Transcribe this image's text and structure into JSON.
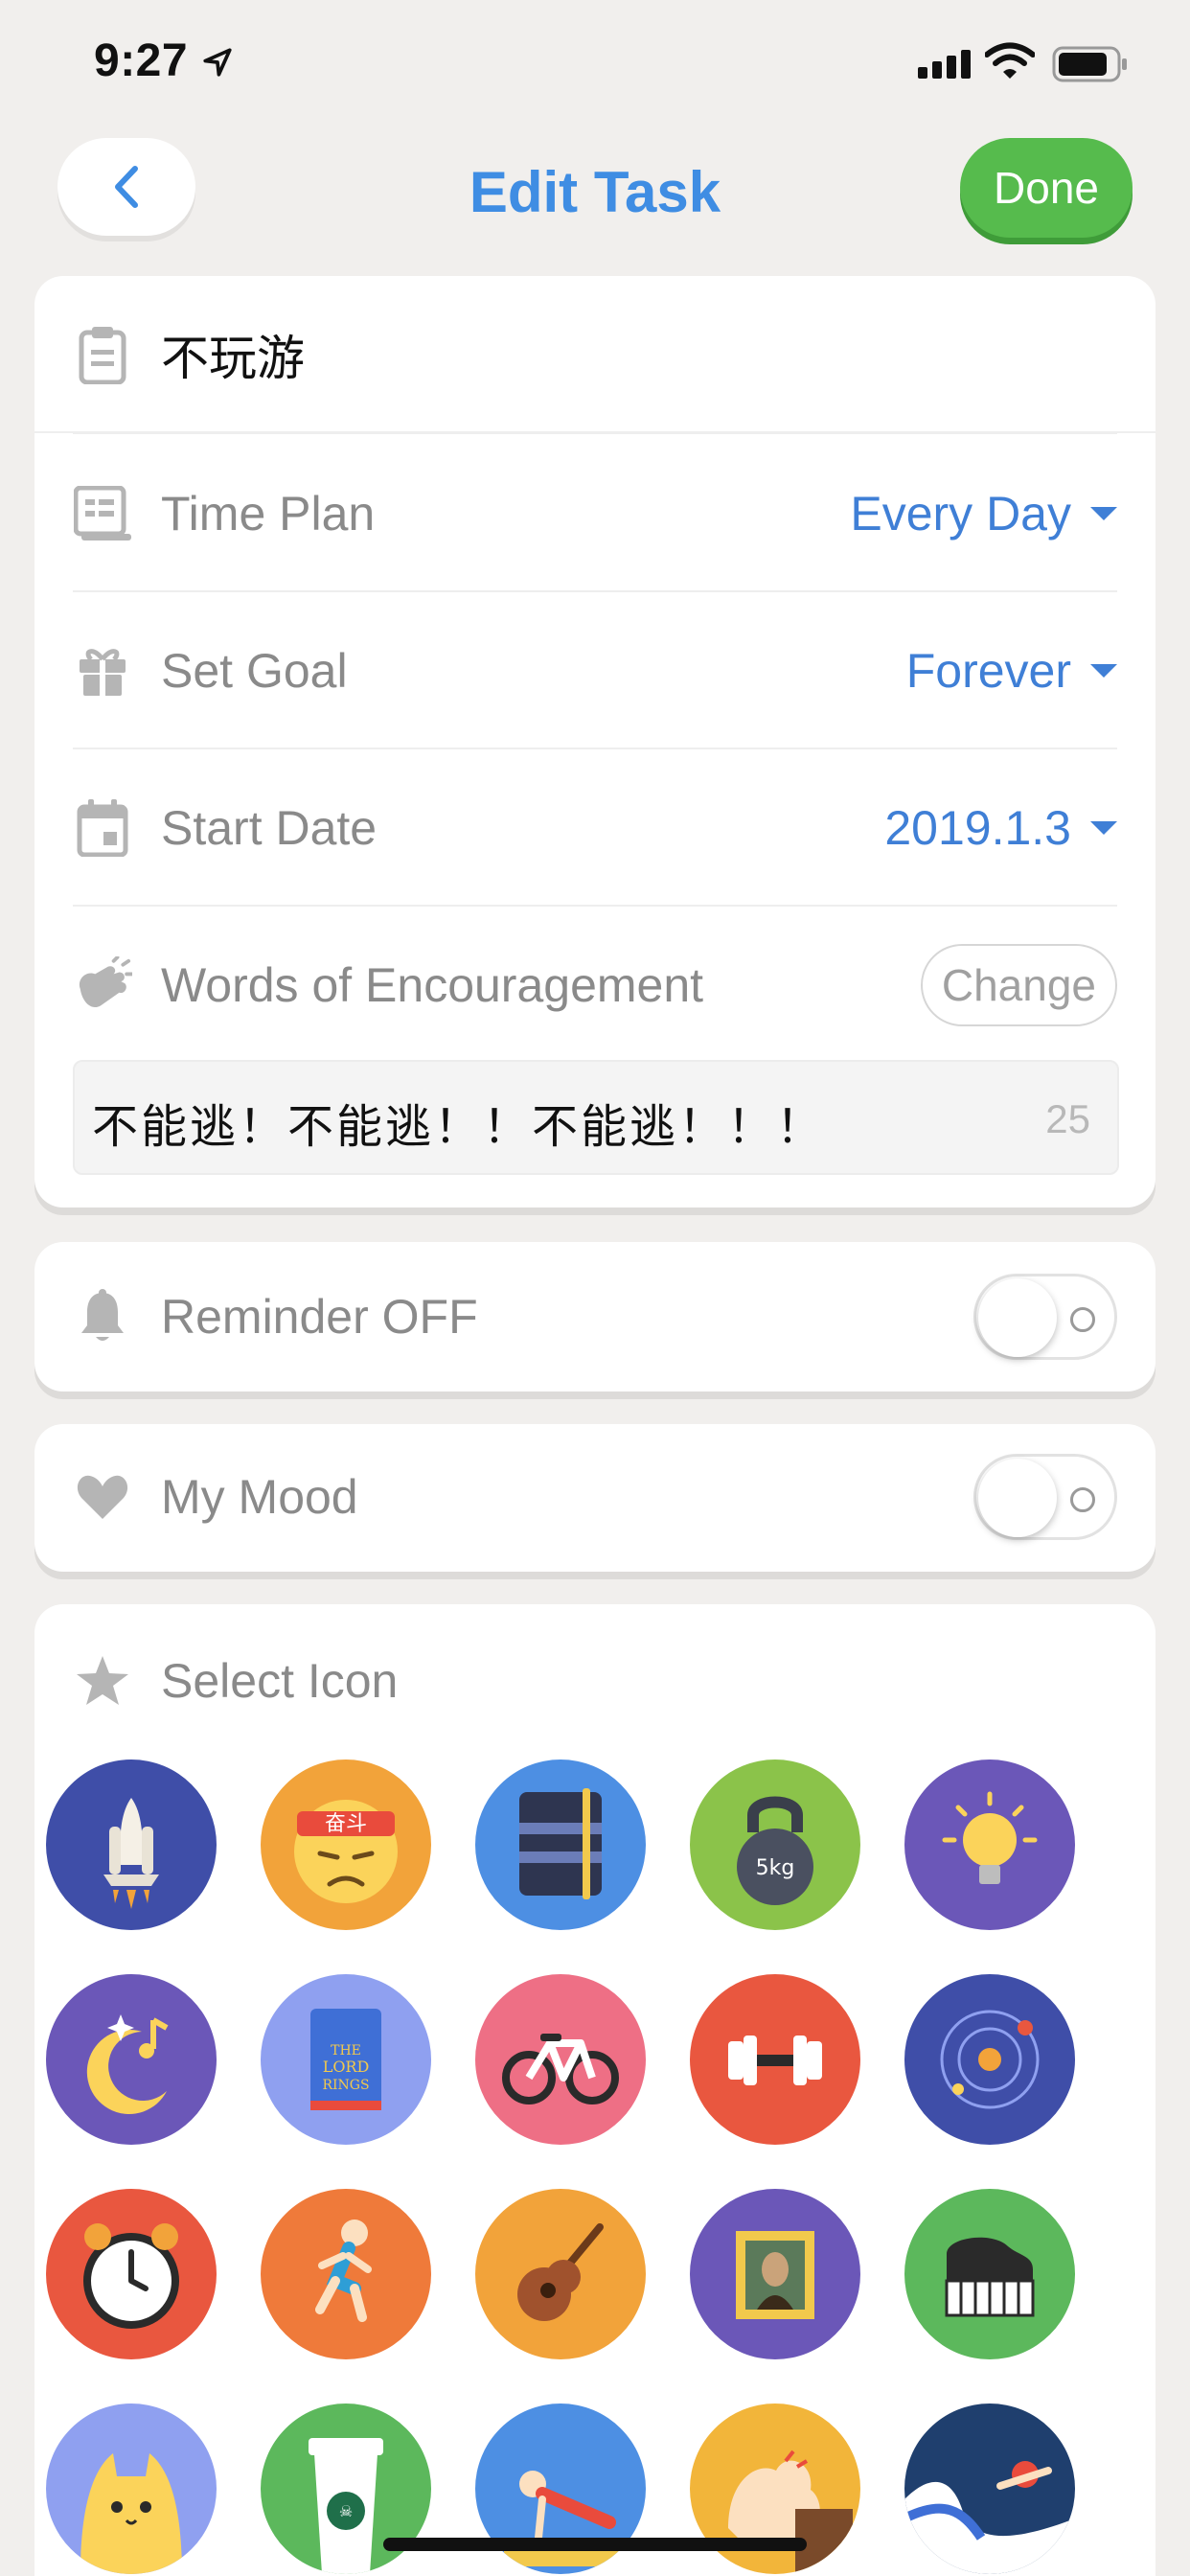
{
  "status": {
    "time": "9:27"
  },
  "nav": {
    "title": "Edit Task",
    "done_label": "Done"
  },
  "task": {
    "name": "不玩游",
    "time_plan_label": "Time Plan",
    "time_plan_value": "Every Day",
    "goal_label": "Set Goal",
    "goal_value": "Forever",
    "start_label": "Start Date",
    "start_value": "2019.1.3",
    "encouragement_label": "Words of Encouragement",
    "change_label": "Change",
    "encouragement_text": "不能逃！不能逃！！不能逃！！！",
    "char_count": "25"
  },
  "reminder": {
    "label": "Reminder OFF",
    "on": false
  },
  "mood": {
    "label": "My Mood",
    "on": false
  },
  "icons": {
    "label": "Select Icon",
    "items": [
      {
        "name": "rocket-icon",
        "bg": "#3f4ea8"
      },
      {
        "name": "headband-face-icon",
        "bg": "#f2a33a",
        "text": "奋斗"
      },
      {
        "name": "notebook-icon",
        "bg": "#4d8fe3"
      },
      {
        "name": "kettlebell-icon",
        "bg": "#8bc34a",
        "text": "5kg"
      },
      {
        "name": "lightbulb-icon",
        "bg": "#6b57b8"
      },
      {
        "name": "moon-music-icon",
        "bg": "#6b57b8"
      },
      {
        "name": "book-icon",
        "bg": "#8fa0f0"
      },
      {
        "name": "bicycle-icon",
        "bg": "#ee6f85"
      },
      {
        "name": "dumbbell-icon",
        "bg": "#e9573f"
      },
      {
        "name": "planet-icon",
        "bg": "#3f4ea8"
      },
      {
        "name": "alarm-clock-icon",
        "bg": "#e9573f"
      },
      {
        "name": "runner-icon",
        "bg": "#ef7a3a"
      },
      {
        "name": "guitar-icon",
        "bg": "#f2a33a"
      },
      {
        "name": "painting-icon",
        "bg": "#6b57b8"
      },
      {
        "name": "piano-icon",
        "bg": "#5cb85c"
      },
      {
        "name": "cat-icon",
        "bg": "#8fa0f0"
      },
      {
        "name": "coffee-icon",
        "bg": "#5cb85c"
      },
      {
        "name": "pushup-icon",
        "bg": "#4d8fe3"
      },
      {
        "name": "muscle-icon",
        "bg": "#f2b53a"
      },
      {
        "name": "swimmer-icon",
        "bg": "#1f3f6e"
      }
    ]
  }
}
